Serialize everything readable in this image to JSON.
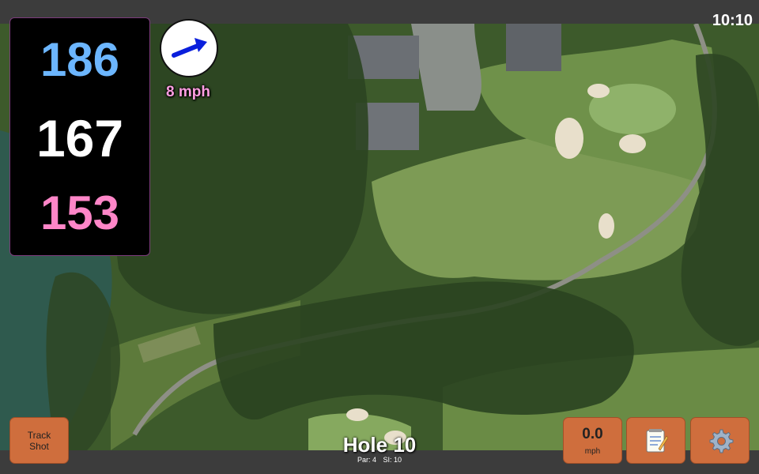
{
  "status_bar": {
    "time": "10:10"
  },
  "distances": {
    "back": "186",
    "middle": "167",
    "front": "153"
  },
  "wind": {
    "speed": "8 mph",
    "direction_icon": "wind-arrow-icon"
  },
  "buttons": {
    "track_shot_line1": "Track",
    "track_shot_line2": "Shot",
    "speed_value": "0.0",
    "speed_unit": "mph",
    "notes_icon": "notepad-icon",
    "settings_icon": "gear-icon"
  },
  "hole": {
    "label": "Hole 10",
    "par": "Par: 4",
    "si": "SI: 10"
  },
  "colors": {
    "back_distance": "#6cb6ff",
    "middle_distance": "#ffffff",
    "front_distance": "#ff86c8",
    "wind_text": "#ff9ee2",
    "button": "#cf6e3d"
  }
}
